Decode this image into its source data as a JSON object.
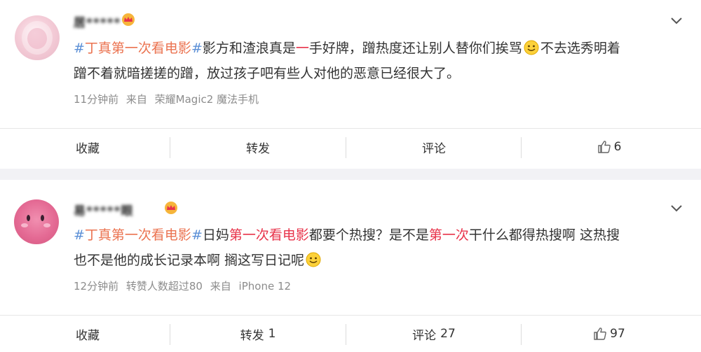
{
  "posts": [
    {
      "username": "居*****",
      "text": {
        "hashtag_mark_open": "#",
        "hashtag": "丁真第一次看电影",
        "hashtag_mark_close": "#",
        "part1": "影方和渣浪真是",
        "hl1": "一",
        "part2": "手好牌，蹭热度还让别人替你们挨骂",
        "line1_end": "不去选秀明着",
        "line2": "蹭不着就暗搓搓的蹭，放过孩子吧有些人对他的恶意已经很大了。"
      },
      "meta": {
        "time": "11分钟前",
        "from_label": "来自",
        "source": "荣耀Magic2 魔法手机"
      },
      "actions": {
        "favorite": "收藏",
        "repost": "转发",
        "repost_count": "",
        "comment": "评论",
        "comment_count": "",
        "like_count": "6"
      }
    },
    {
      "username": "易*****眼",
      "text": {
        "hashtag_mark_open": "#",
        "hashtag": "丁真第一次看电影",
        "hashtag_mark_close": "#",
        "part1": "日妈",
        "hl1": "第一次看电影",
        "part2": "都要个热搜？是不是",
        "hl2": "第一次",
        "part3": "干什么都得热搜啊 这热搜",
        "line2": "也不是他的成长记录本啊 搁这写日记呢"
      },
      "meta": {
        "time": "12分钟前",
        "extra": "转赞人数超过80",
        "from_label": "来自",
        "source": "iPhone 12"
      },
      "actions": {
        "favorite": "收藏",
        "repost": "转发",
        "repost_count": "1",
        "comment": "评论",
        "comment_count": "27",
        "like_count": "97"
      }
    }
  ],
  "colors": {
    "hashtag": "#eb7350",
    "hash_mark": "#5b8fd6",
    "highlight": "#e8334a",
    "meta": "#8c8c8c",
    "separator": "#f2f2f5"
  },
  "icons": [
    "avatar",
    "crown-badge-icon",
    "chevron-down-icon",
    "smile-emoji-icon",
    "thumbs-up-icon"
  ]
}
